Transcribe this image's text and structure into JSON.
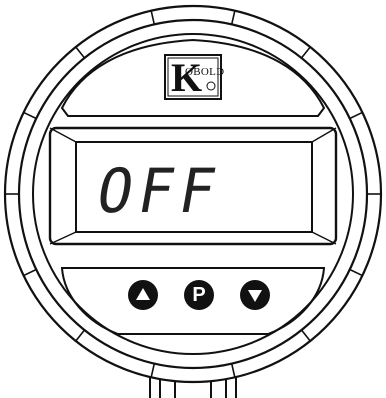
{
  "logo": {
    "initial": "K",
    "text": "OBOLD"
  },
  "display": {
    "text": "OFF"
  },
  "buttons": {
    "p_label": "P"
  },
  "icons": {
    "up": "triangle-up-icon",
    "program": "p-button-icon",
    "down": "triangle-down-icon"
  },
  "colors": {
    "outline": "#111111",
    "background": "#ffffff",
    "buttons": "#111111"
  }
}
